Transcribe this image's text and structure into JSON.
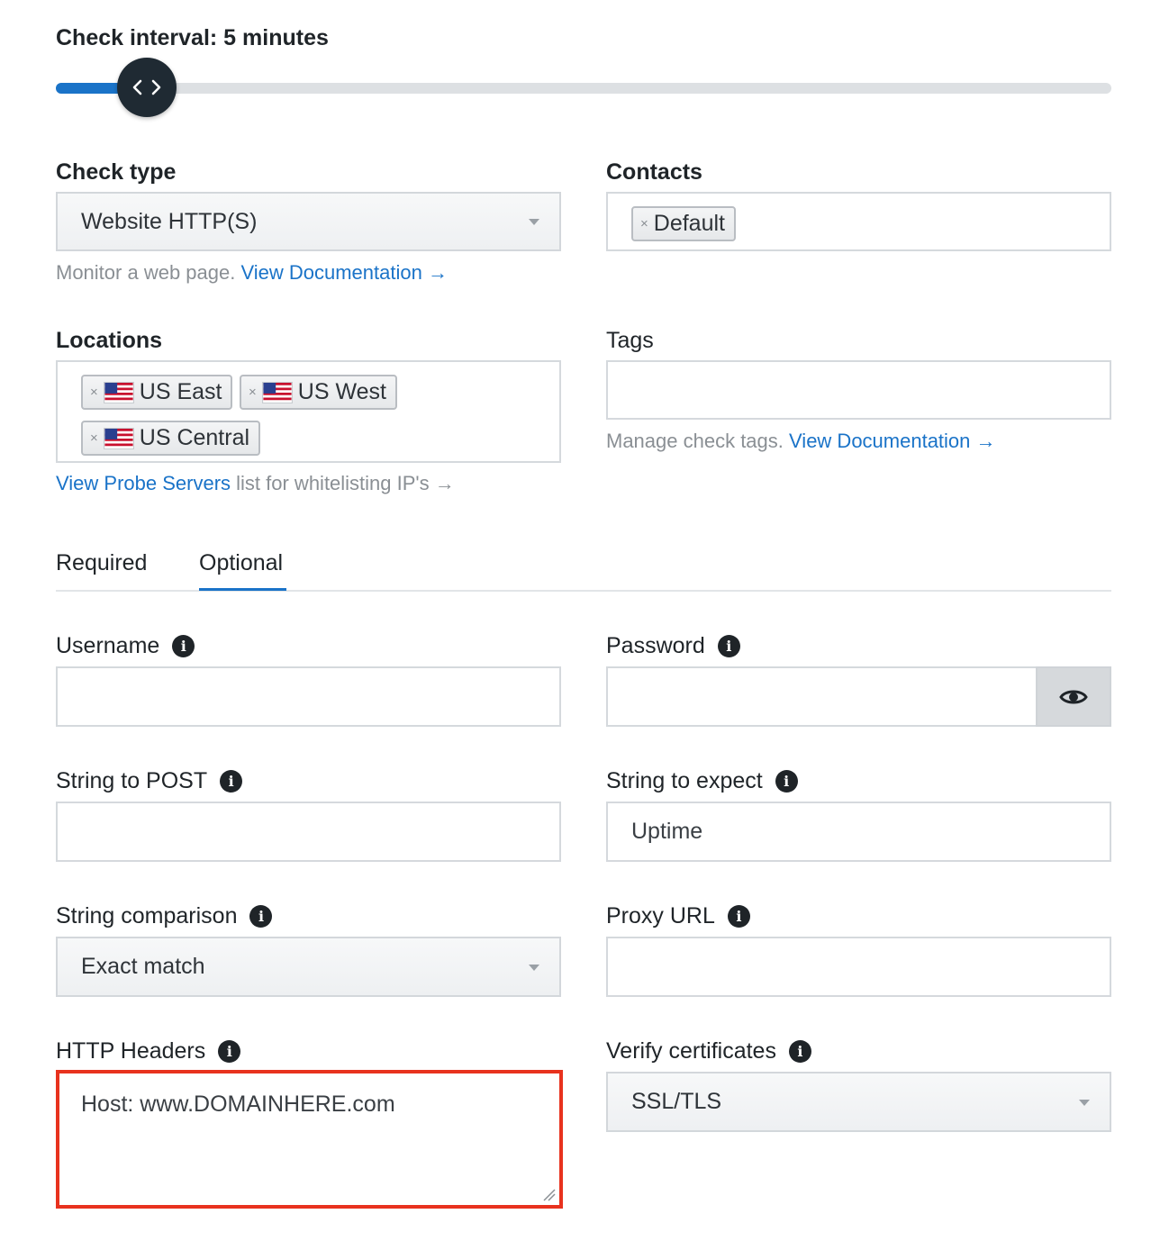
{
  "check_interval": {
    "label": "Check interval: 5 minutes",
    "slider_fraction": 0.06
  },
  "check_type": {
    "label": "Check type",
    "selected": "Website HTTP(S)",
    "help_text": "Monitor a web page.",
    "help_link": "View Documentation",
    "help_arrow": "→"
  },
  "contacts": {
    "label": "Contacts",
    "tags": [
      {
        "remove": "×",
        "text": "Default"
      }
    ]
  },
  "locations": {
    "label": "Locations",
    "tags": [
      {
        "remove": "×",
        "text": "US East",
        "icon": "us-flag-icon"
      },
      {
        "remove": "×",
        "text": "US West",
        "icon": "us-flag-icon"
      },
      {
        "remove": "×",
        "text": "US Central",
        "icon": "us-flag-icon"
      }
    ],
    "help_link": "View Probe Servers",
    "help_text": "list for whitelisting IP's",
    "help_arrow": "→"
  },
  "tags": {
    "label": "Tags",
    "value": "",
    "help_text": "Manage check tags.",
    "help_link": "View Documentation",
    "help_arrow": "→"
  },
  "tabs": [
    {
      "label": "Required",
      "active": false
    },
    {
      "label": "Optional",
      "active": true
    }
  ],
  "username": {
    "label": "Username",
    "value": "",
    "icon": "info-icon"
  },
  "password": {
    "label": "Password",
    "value": "",
    "icon": "info-icon",
    "toggle_icon": "eye-icon"
  },
  "string_to_post": {
    "label": "String to POST",
    "value": "",
    "icon": "info-icon"
  },
  "string_to_expect": {
    "label": "String to expect",
    "value": "Uptime",
    "icon": "info-icon"
  },
  "string_comparison": {
    "label": "String comparison",
    "selected": "Exact match",
    "icon": "info-icon"
  },
  "proxy_url": {
    "label": "Proxy URL",
    "value": "",
    "icon": "info-icon"
  },
  "http_headers": {
    "label": "HTTP Headers",
    "value": "Host: www.DOMAINHERE.com",
    "icon": "info-icon",
    "highlight_color": "#e8321e"
  },
  "verify_certificates": {
    "label": "Verify certificates",
    "selected": "SSL/TLS",
    "icon": "info-icon"
  },
  "colors": {
    "accent": "#1a73c8",
    "slider_thumb": "#1f2a33",
    "highlight": "#e8321e"
  }
}
